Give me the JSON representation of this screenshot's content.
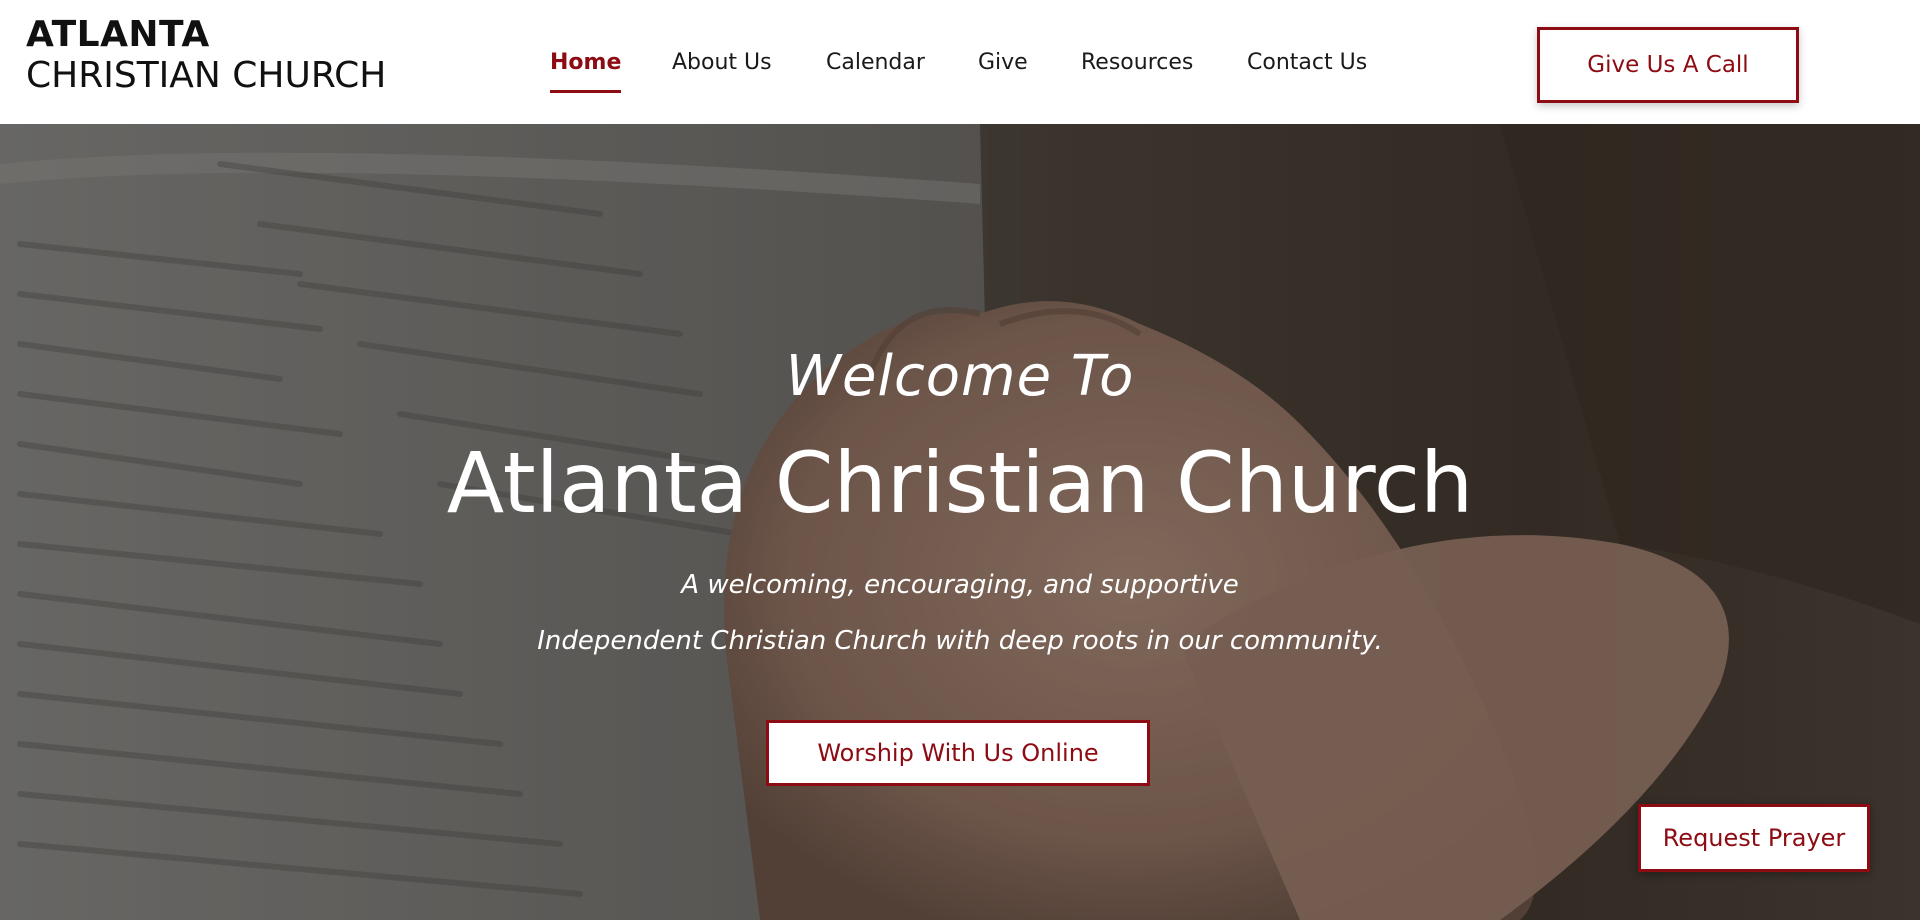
{
  "header": {
    "logo_line1": "ATLANTA",
    "logo_line2": "CHRISTIAN CHURCH",
    "nav": [
      {
        "label": "Home",
        "active": true
      },
      {
        "label": "About Us",
        "active": false
      },
      {
        "label": "Calendar",
        "active": false
      },
      {
        "label": "Give",
        "active": false
      },
      {
        "label": "Resources",
        "active": false
      },
      {
        "label": "Contact Us",
        "active": false
      }
    ],
    "call_button": "Give Us A Call"
  },
  "hero": {
    "welcome": "Welcome To",
    "title": "Atlanta Christian Church",
    "tagline_line1": "A welcoming, encouraging, and supportive",
    "tagline_line2": "Independent Christian Church with deep roots in our community.",
    "worship_button": "Worship With Us Online",
    "prayer_button": "Request Prayer"
  },
  "colors": {
    "accent": "#8d0b12",
    "header_bg": "#ffffff",
    "text_dark": "#111111"
  }
}
